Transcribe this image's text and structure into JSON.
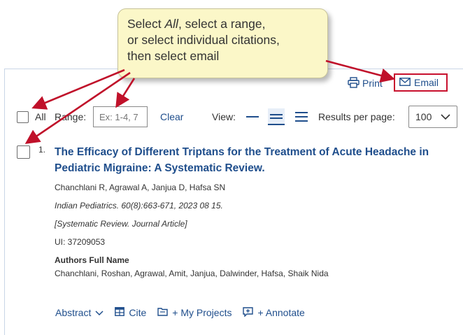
{
  "callout": {
    "line1_pre": "Select ",
    "line1_em": "All",
    "line1_post": ", select a range,",
    "line2": "or select individual citations,",
    "line3": "then select email"
  },
  "top_links": {
    "print": "Print",
    "email": "Email"
  },
  "toolbar": {
    "all_label": "All",
    "range_label": "Range:",
    "range_placeholder": "Ex: 1-4, 7",
    "clear": "Clear",
    "view_label": "View:",
    "results_per_page_label": "Results per page:",
    "results_per_page_value": "100"
  },
  "result": {
    "number": "1.",
    "title": "The Efficacy of Different Triptans for the Treatment of Acute Headache in Pediatric Migraine: A Systematic Review.",
    "authors": "Chanchlani R, Agrawal A, Janjua D, Hafsa SN",
    "source": "Indian Pediatrics. 60(8):663-671, 2023 08 15.",
    "type": "[Systematic Review. Journal Article]",
    "ui": "UI: 37209053",
    "authors_full_name_heading": "Authors Full Name",
    "authors_full_name": "Chanchlani, Roshan, Agrawal, Amit, Janjua, Dalwinder, Hafsa, Shaik Nida",
    "actions": {
      "abstract": "Abstract",
      "cite": "Cite",
      "my_projects": "+ My Projects",
      "annotate": "+ Annotate"
    }
  },
  "colors": {
    "link": "#1f4e8c",
    "callout_bg": "#fbf7c8",
    "arrow": "#c0112a"
  },
  "icons": [
    "printer-icon",
    "envelope-icon",
    "view-compact-icon",
    "view-standard-icon",
    "view-expanded-icon",
    "chevron-down-icon",
    "table-icon",
    "folder-icon",
    "annotate-icon"
  ]
}
